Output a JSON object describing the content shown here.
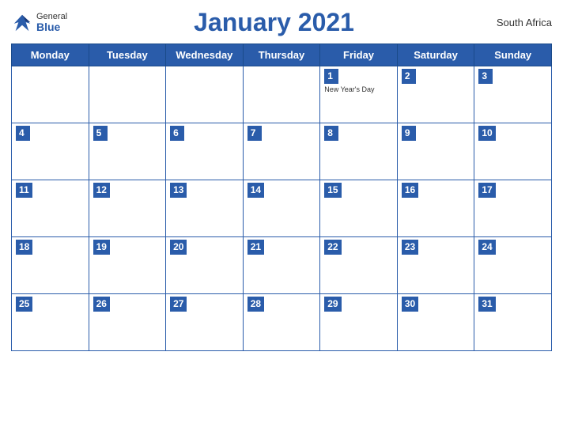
{
  "logo": {
    "general": "General",
    "blue": "Blue"
  },
  "header": {
    "title": "January 2021",
    "country": "South Africa"
  },
  "days_of_week": [
    "Monday",
    "Tuesday",
    "Wednesday",
    "Thursday",
    "Friday",
    "Saturday",
    "Sunday"
  ],
  "weeks": [
    [
      {
        "day": "",
        "empty": true
      },
      {
        "day": "",
        "empty": true
      },
      {
        "day": "",
        "empty": true
      },
      {
        "day": "",
        "empty": true
      },
      {
        "day": "1",
        "holiday": "New Year's Day"
      },
      {
        "day": "2"
      },
      {
        "day": "3"
      }
    ],
    [
      {
        "day": "4"
      },
      {
        "day": "5"
      },
      {
        "day": "6"
      },
      {
        "day": "7"
      },
      {
        "day": "8"
      },
      {
        "day": "9"
      },
      {
        "day": "10"
      }
    ],
    [
      {
        "day": "11"
      },
      {
        "day": "12"
      },
      {
        "day": "13"
      },
      {
        "day": "14"
      },
      {
        "day": "15"
      },
      {
        "day": "16"
      },
      {
        "day": "17"
      }
    ],
    [
      {
        "day": "18"
      },
      {
        "day": "19"
      },
      {
        "day": "20"
      },
      {
        "day": "21"
      },
      {
        "day": "22"
      },
      {
        "day": "23"
      },
      {
        "day": "24"
      }
    ],
    [
      {
        "day": "25"
      },
      {
        "day": "26"
      },
      {
        "day": "27"
      },
      {
        "day": "28"
      },
      {
        "day": "29"
      },
      {
        "day": "30"
      },
      {
        "day": "31"
      }
    ]
  ]
}
